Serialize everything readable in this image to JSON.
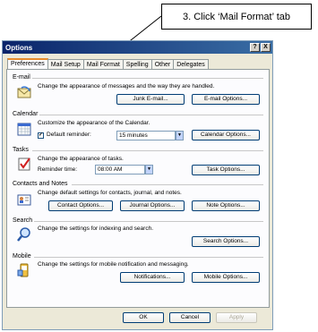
{
  "callout": {
    "text": "3. Click ‘Mail Format’ tab"
  },
  "dialog": {
    "title": "Options",
    "help_label": "?",
    "close_label": "X",
    "tabs": [
      "Preferences",
      "Mail Setup",
      "Mail Format",
      "Spelling",
      "Other",
      "Delegates"
    ],
    "active_tab": "Preferences"
  },
  "sections": {
    "email": {
      "label": "E-mail",
      "desc": "Change the appearance of messages and the way they are handled.",
      "junk_button": "Junk E-mail...",
      "options_button": "E-mail Options..."
    },
    "calendar": {
      "label": "Calendar",
      "desc": "Customize the appearance of the Calendar.",
      "reminder_label": "Default reminder:",
      "reminder_checked": true,
      "reminder_value": "15 minutes",
      "options_button": "Calendar Options..."
    },
    "tasks": {
      "label": "Tasks",
      "desc": "Change the appearance of tasks.",
      "reminder_label": "Reminder time:",
      "reminder_value": "08:00 AM",
      "options_button": "Task Options..."
    },
    "contacts": {
      "label": "Contacts and Notes",
      "desc": "Change default settings for contacts, journal, and notes.",
      "contact_button": "Contact Options...",
      "journal_button": "Journal Options...",
      "note_button": "Note Options..."
    },
    "search": {
      "label": "Search",
      "desc": "Change the settings for indexing and search.",
      "options_button": "Search Options..."
    },
    "mobile": {
      "label": "Mobile",
      "desc": "Change the settings for mobile notification and messaging.",
      "notifications_button": "Notifications...",
      "options_button": "Mobile Options..."
    }
  },
  "footer": {
    "ok": "OK",
    "cancel": "Cancel",
    "apply": "Apply"
  }
}
